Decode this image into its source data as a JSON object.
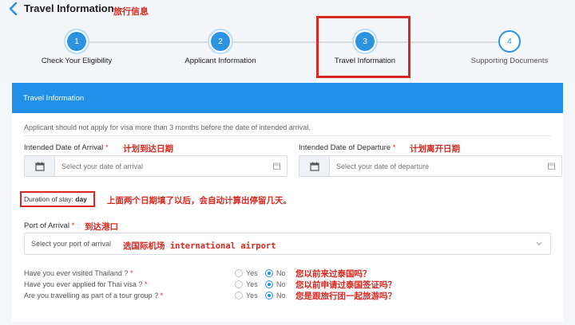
{
  "header": {
    "title": "Travel Information",
    "annotation": "旅行信息"
  },
  "stepper": {
    "steps": [
      {
        "number": "1",
        "label": "Check Your Eligibility",
        "state": "done"
      },
      {
        "number": "2",
        "label": "Applicant Information",
        "state": "done"
      },
      {
        "number": "3",
        "label": "Travel Information",
        "state": "active"
      },
      {
        "number": "4",
        "label": "Supporting Documents",
        "state": "pending"
      }
    ]
  },
  "form": {
    "section_title": "Travel Information",
    "notice": "Applicant should not apply for visa more than 3 months before the date of intended arrival.",
    "arrival": {
      "label": "Intended Date of Arrival",
      "required_mark": "*",
      "placeholder": "Select your date of arrival",
      "annotation": "计划到达日期"
    },
    "departure": {
      "label": "Intended Date of Departure",
      "required_mark": "*",
      "placeholder": "Select your date of departure",
      "annotation": "计划离开日期"
    },
    "duration": {
      "label": "Duration of stay:",
      "unit": "day",
      "annotation": "上面两个日期填了以后，会自动计算出停留几天。"
    },
    "port": {
      "label": "Port of Arrival",
      "required_mark": "*",
      "placeholder": "Select your port of arrival",
      "annotation_label": "到达港口",
      "annotation_select": "选国际机场 international airport"
    },
    "questions": [
      {
        "text": "Have you ever visited Thailand ?",
        "required_mark": "*",
        "yes": "Yes",
        "no": "No",
        "selected": "No",
        "annotation": "您以前来过泰国吗？"
      },
      {
        "text": "Have you ever applied for Thai visa ?",
        "required_mark": "*",
        "yes": "Yes",
        "no": "No",
        "selected": "No",
        "annotation": "您以前申请过泰国签证吗？"
      },
      {
        "text": "Are you travelling as part of a tour group ?",
        "required_mark": "*",
        "yes": "Yes",
        "no": "No",
        "selected": "No",
        "annotation": "您是跟旅行团一起旅游吗？"
      }
    ]
  },
  "colors": {
    "primary": "#2290e8",
    "annotation_red": "#d9281f"
  }
}
